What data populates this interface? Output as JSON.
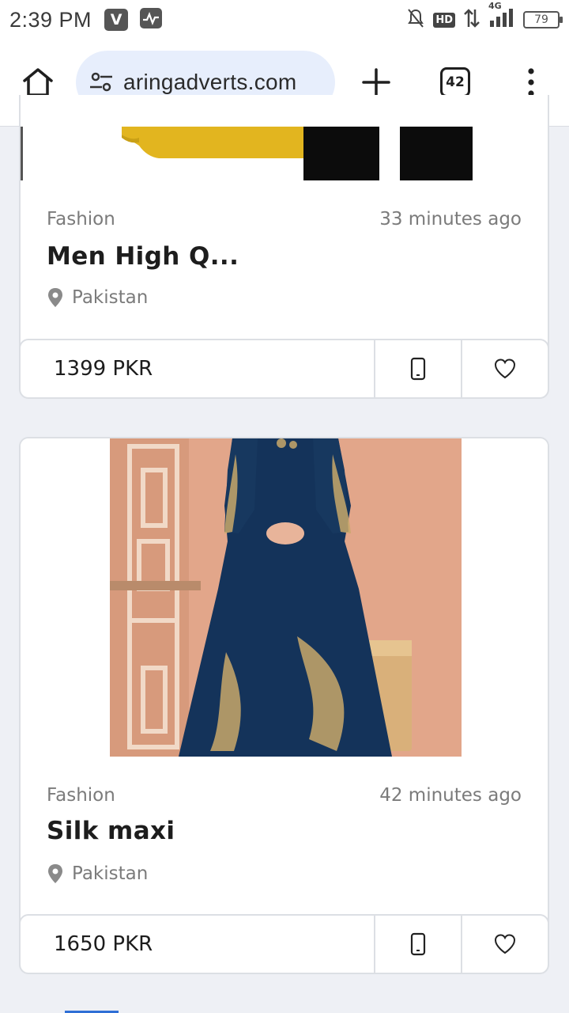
{
  "status_bar": {
    "time": "2:39 PM",
    "network": "4G",
    "hd_label": "HD",
    "battery": "79"
  },
  "browser": {
    "url": "aringadverts.com",
    "tab_count": "42"
  },
  "listings": [
    {
      "category": "Fashion",
      "time_ago": "33 minutes ago",
      "title": "Men High Q...",
      "location": "Pakistan",
      "price": "1399 PKR"
    },
    {
      "category": "Fashion",
      "time_ago": "42 minutes ago",
      "title": "Silk maxi",
      "location": "Pakistan",
      "price": "1650 PKR"
    }
  ],
  "icons": {
    "home": "home-icon",
    "site_settings": "tune-icon",
    "new_tab": "plus-icon",
    "menu": "more-vert-icon",
    "location": "location-pin-icon",
    "phone": "phone-icon",
    "favorite": "heart-icon"
  }
}
